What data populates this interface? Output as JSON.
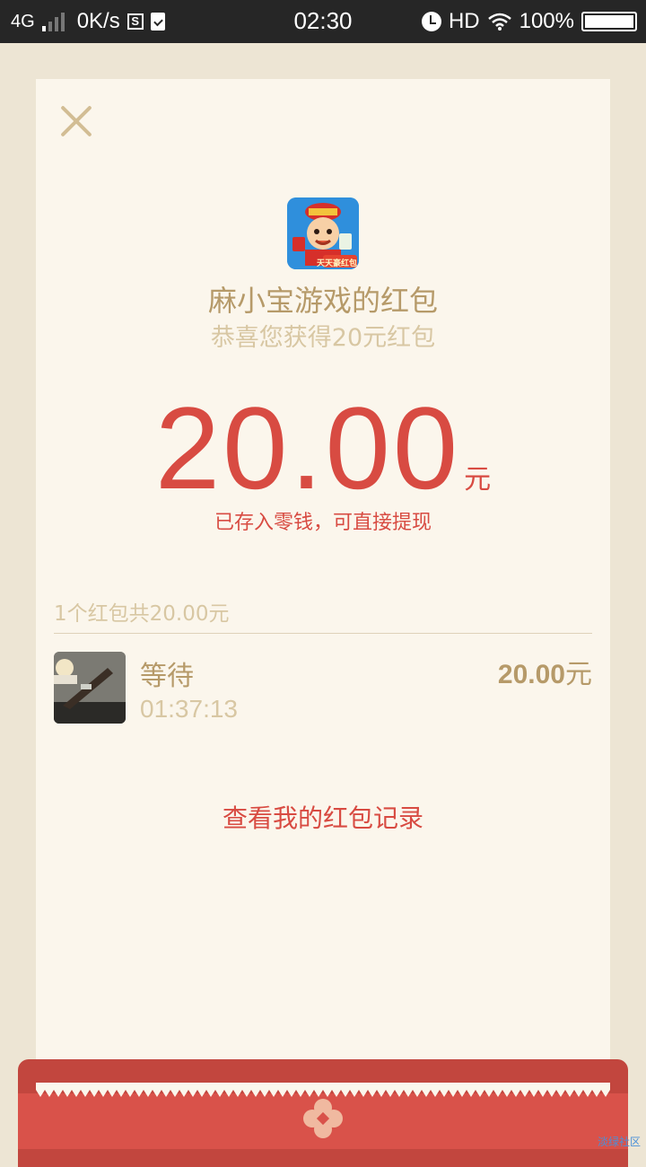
{
  "status_bar": {
    "network": "4G",
    "speed": "0K/s",
    "s_icon_letter": "S",
    "time": "02:30",
    "hd": "HD",
    "battery": "100%"
  },
  "card": {
    "app_title": "麻小宝游戏的红包",
    "app_subtitle": "恭喜您获得20元红包",
    "app_icon_caption": "天天豪红包",
    "amount": "20.00",
    "amount_unit": "元",
    "stored_note": "已存入零钱，可直接提现",
    "summary": "1个红包共20.00元",
    "record": {
      "status": "等待",
      "time": "01:37:13",
      "amount": "20.00",
      "amount_unit": "元"
    },
    "history_link": "查看我的红包记录"
  },
  "colors": {
    "accent_red": "#d84b42",
    "gold_text": "#b69a69",
    "light_gold_text": "#d8c7a3",
    "card_bg": "#fbf6ec",
    "page_bg": "#ede5d4"
  },
  "watermark": "淡绿社区"
}
